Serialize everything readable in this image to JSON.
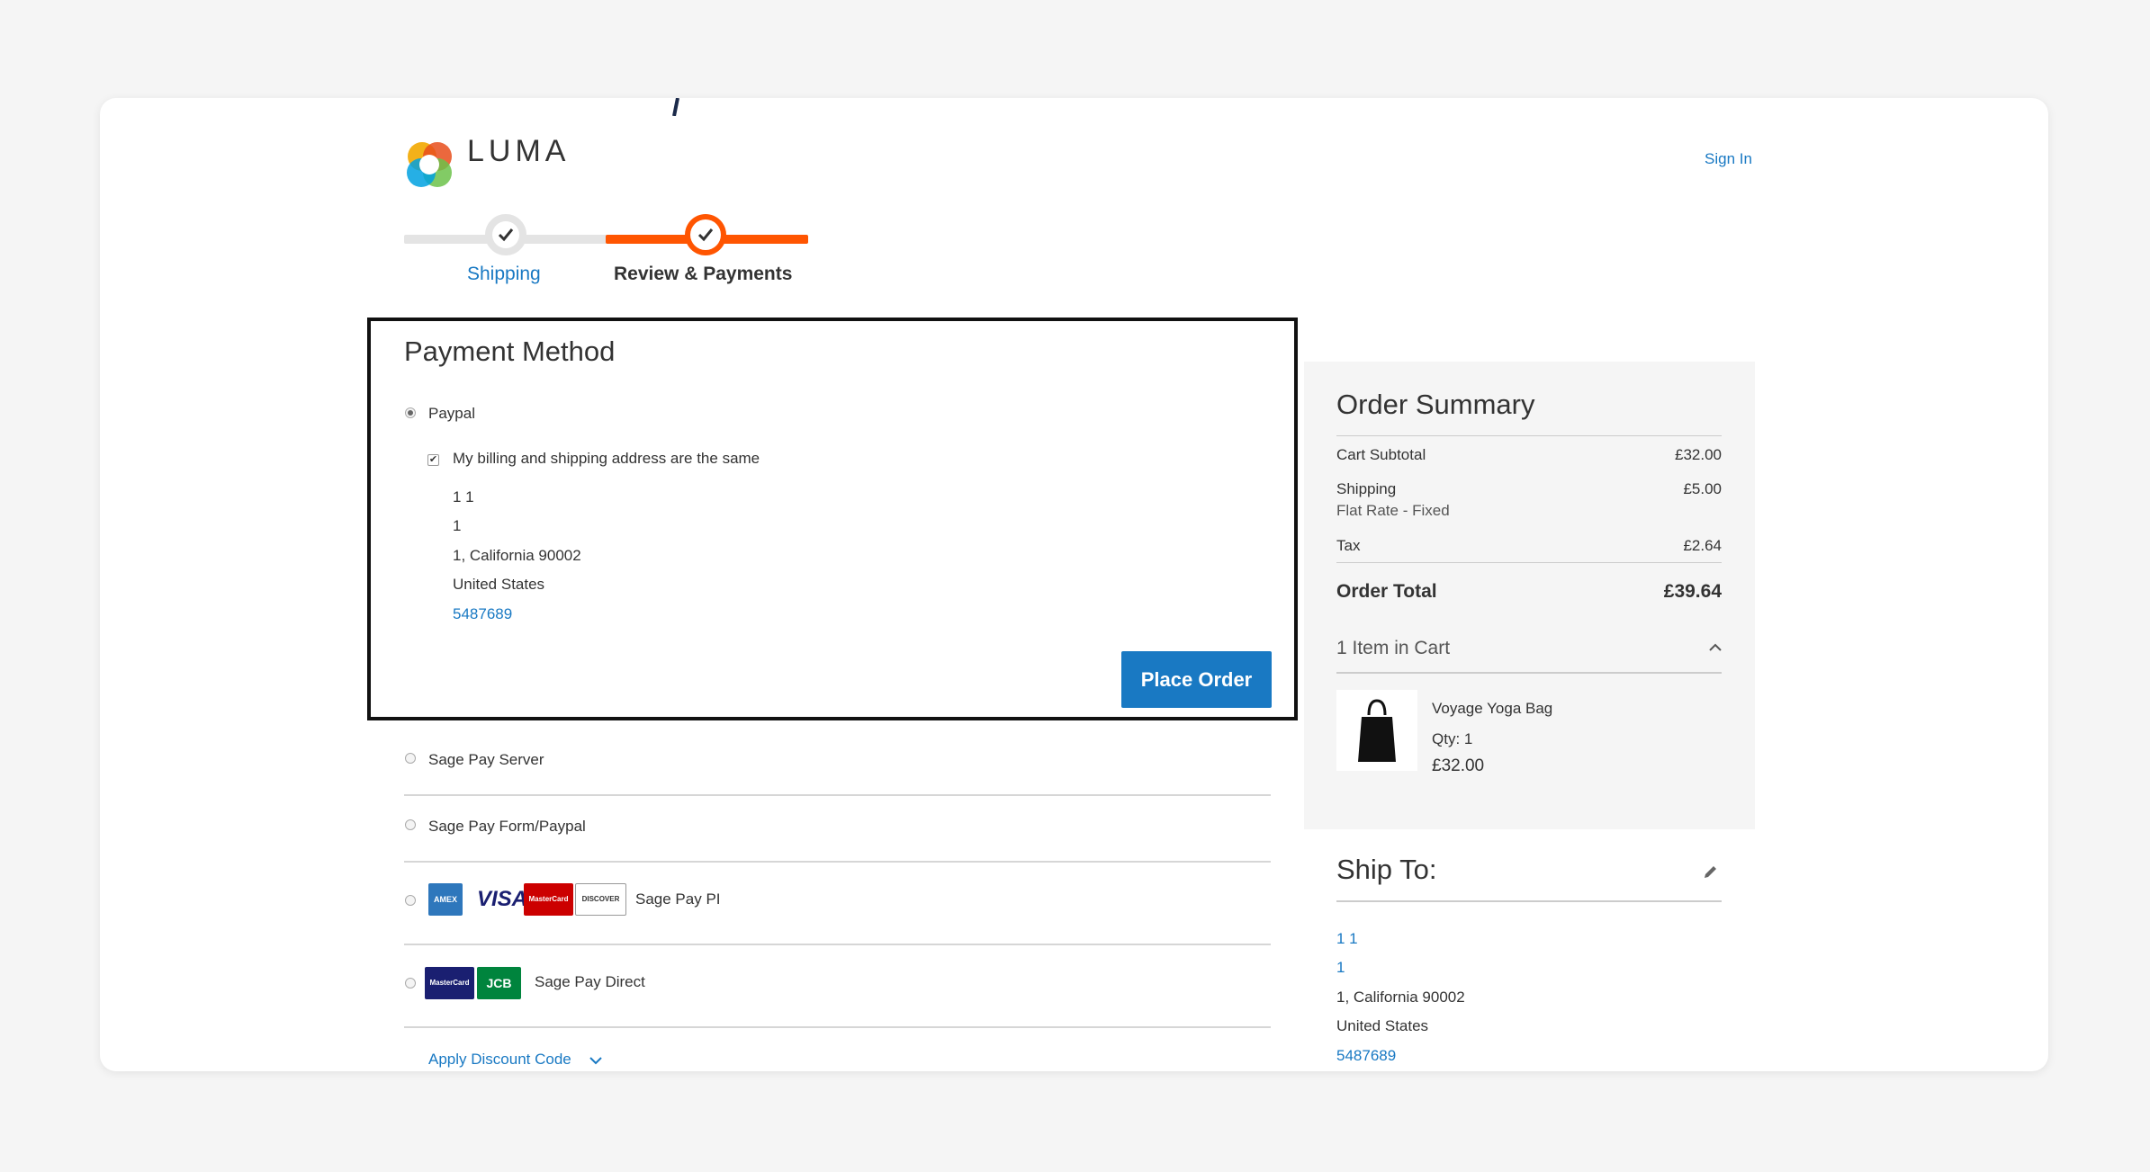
{
  "header": {
    "logo_text": "LUMA",
    "sign_in": "Sign In"
  },
  "progress": {
    "steps": [
      {
        "label": "Shipping",
        "state": "completed"
      },
      {
        "label": "Review & Payments",
        "state": "active"
      }
    ]
  },
  "payment": {
    "title": "Payment Method",
    "selected_method": "Paypal",
    "same_address_label": "My billing and shipping address are the same",
    "same_address_checked": true,
    "address": {
      "name": "1 1",
      "street": "1",
      "city_region": "1, California 90002",
      "country": "United States",
      "phone": "5487689"
    },
    "place_order": "Place Order",
    "other_methods": [
      {
        "label": "Sage Pay Server"
      },
      {
        "label": "Sage Pay Form/Paypal"
      },
      {
        "label": "Sage Pay PI",
        "cards": [
          "AMEX",
          "VISA",
          "MasterCard",
          "DISCOVER"
        ]
      },
      {
        "label": "Sage Pay Direct",
        "cards": [
          "MasterCard",
          "JCB"
        ]
      }
    ],
    "discount_link": "Apply Discount Code"
  },
  "summary": {
    "title": "Order Summary",
    "rows": {
      "subtotal_label": "Cart Subtotal",
      "subtotal_value": "£32.00",
      "shipping_label": "Shipping",
      "shipping_sub": "Flat Rate - Fixed",
      "shipping_value": "£5.00",
      "tax_label": "Tax",
      "tax_value": "£2.64",
      "total_label": "Order Total",
      "total_value": "£39.64"
    },
    "items_in_cart": "1 Item in Cart",
    "item": {
      "name": "Voyage Yoga Bag",
      "qty": "Qty: 1",
      "price": "£32.00"
    }
  },
  "ship_to": {
    "title": "Ship To:",
    "address": {
      "name": "1 1",
      "street": "1",
      "city_region": "1, California 90002",
      "country": "United States",
      "phone": "5487689"
    }
  },
  "colors": {
    "accent": "#ff5501",
    "link": "#1979c3",
    "button": "#1979c3"
  }
}
